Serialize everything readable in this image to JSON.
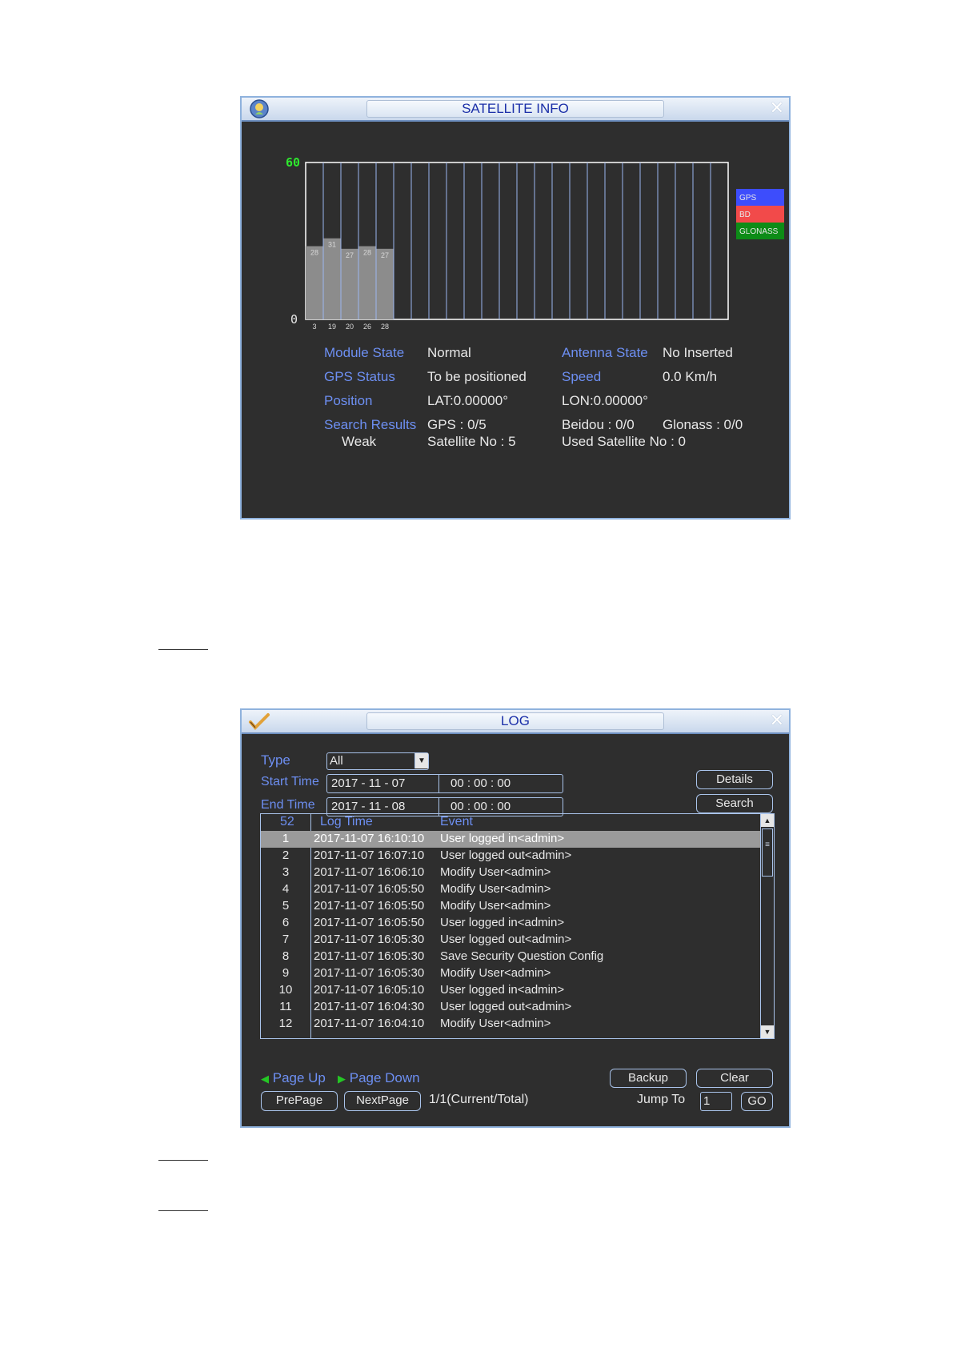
{
  "satellite": {
    "title": "SATELLITE INFO",
    "chart_data": {
      "type": "bar",
      "ylim": [
        0,
        60
      ],
      "y_ticks": [
        "60",
        "0"
      ],
      "slots": 24,
      "satellites": [
        "3",
        "19",
        "20",
        "26",
        "28"
      ],
      "values": [
        28,
        31,
        27,
        28,
        27
      ],
      "legend": [
        {
          "name": "GPS",
          "color": "#3d4dfc"
        },
        {
          "name": "BD",
          "color": "#f24a4a"
        },
        {
          "name": "GLONASS",
          "color": "#0d8c17"
        }
      ]
    },
    "info": {
      "module_state_label": "Module State",
      "module_state_value": "Normal",
      "antenna_state_label": "Antenna State",
      "antenna_state_value": "No Inserted",
      "gps_status_label": "GPS Status",
      "gps_status_value": "To be positioned",
      "speed_label": "Speed",
      "speed_value": "0.0 Km/h",
      "position_label": "Position",
      "lat": "LAT:0.00000°",
      "lon": "LON:0.00000°",
      "search_results_label": "Search Results",
      "gps_result": "GPS : 0/5",
      "beidou_result": "Beidou : 0/0",
      "glonass_result": "Glonass : 0/0",
      "signal_label": "Weak",
      "satellite_no": "Satellite No : 5",
      "used_satellite_no": "Used Satellite No : 0"
    }
  },
  "log": {
    "title": "LOG",
    "type_label": "Type",
    "type_value": "All",
    "start_time_label": "Start Time",
    "start_date": "2017   - 11 - 07",
    "start_clock": "00  :  00  :  00",
    "end_time_label": "End Time",
    "end_date": "2017   - 11 - 08",
    "end_clock": "00  :  00  :  00",
    "details_button": "Details",
    "search_button": "Search",
    "table": {
      "count": "52",
      "col_time": "Log Time",
      "col_event": "Event",
      "rows": [
        {
          "no": "1",
          "time": "2017-11-07 16:10:10",
          "event": "User logged in<admin>"
        },
        {
          "no": "2",
          "time": "2017-11-07 16:07:10",
          "event": "User logged out<admin>"
        },
        {
          "no": "3",
          "time": "2017-11-07 16:06:10",
          "event": "Modify User<admin>"
        },
        {
          "no": "4",
          "time": "2017-11-07 16:05:50",
          "event": "Modify User<admin>"
        },
        {
          "no": "5",
          "time": "2017-11-07 16:05:50",
          "event": "Modify User<admin>"
        },
        {
          "no": "6",
          "time": "2017-11-07 16:05:50",
          "event": "User logged in<admin>"
        },
        {
          "no": "7",
          "time": "2017-11-07 16:05:30",
          "event": "User logged out<admin>"
        },
        {
          "no": "8",
          "time": "2017-11-07 16:05:30",
          "event": "Save Security Question Config"
        },
        {
          "no": "9",
          "time": "2017-11-07 16:05:30",
          "event": "Modify User<admin>"
        },
        {
          "no": "10",
          "time": "2017-11-07 16:05:10",
          "event": "User logged in<admin>"
        },
        {
          "no": "11",
          "time": "2017-11-07 16:04:30",
          "event": "User logged out<admin>"
        },
        {
          "no": "12",
          "time": "2017-11-07 16:04:10",
          "event": "Modify User<admin>"
        }
      ]
    },
    "page_up": "Page Up",
    "page_down": "Page Down",
    "backup_button": "Backup",
    "clear_button": "Clear",
    "prepage_button": "PrePage",
    "nextpage_button": "NextPage",
    "page_info": "1/1(Current/Total)",
    "jump_to_label": "Jump To",
    "jump_to_value": "1",
    "go_button": "GO"
  }
}
